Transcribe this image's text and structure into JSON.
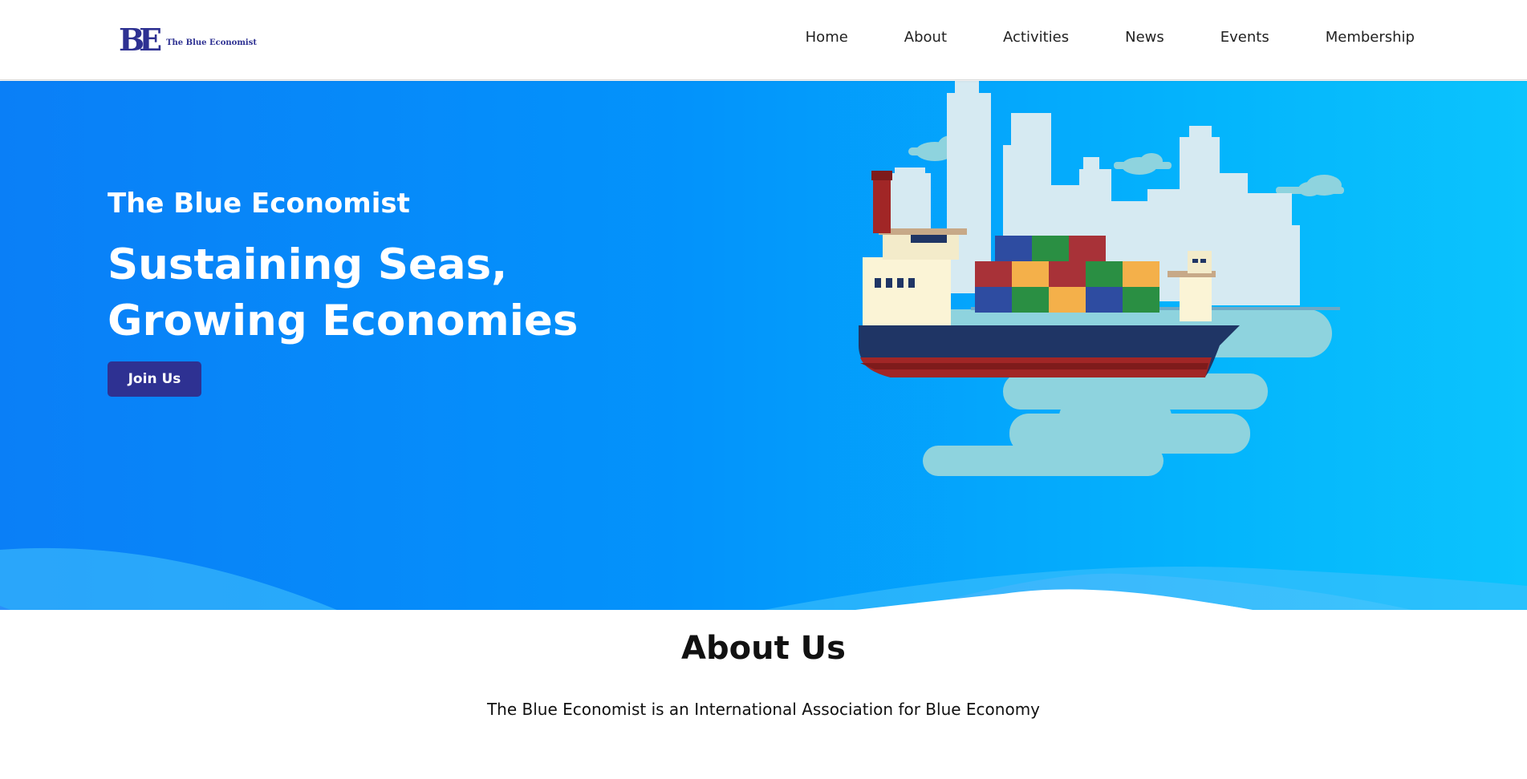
{
  "header": {
    "logo_mark": "BE",
    "logo_text": "The Blue Economist",
    "nav": [
      "Home",
      "About",
      "Activities",
      "News",
      "Events",
      "Membership"
    ]
  },
  "hero": {
    "brand": "The Blue Economist",
    "title_line1": "Sustaining Seas,",
    "title_line2": "Growing Economies",
    "cta_label": "Join Us",
    "illustration": "cargo-ship-city-skyline"
  },
  "about": {
    "title": "About Us",
    "text": "The Blue Economist is an International Association for Blue Economy"
  },
  "colors": {
    "brand": "#2e3192",
    "hero_start": "#0a7ff7",
    "hero_end": "#0bc4fd",
    "accent_light": "#d6eaf2",
    "water": "#8ed3de"
  }
}
